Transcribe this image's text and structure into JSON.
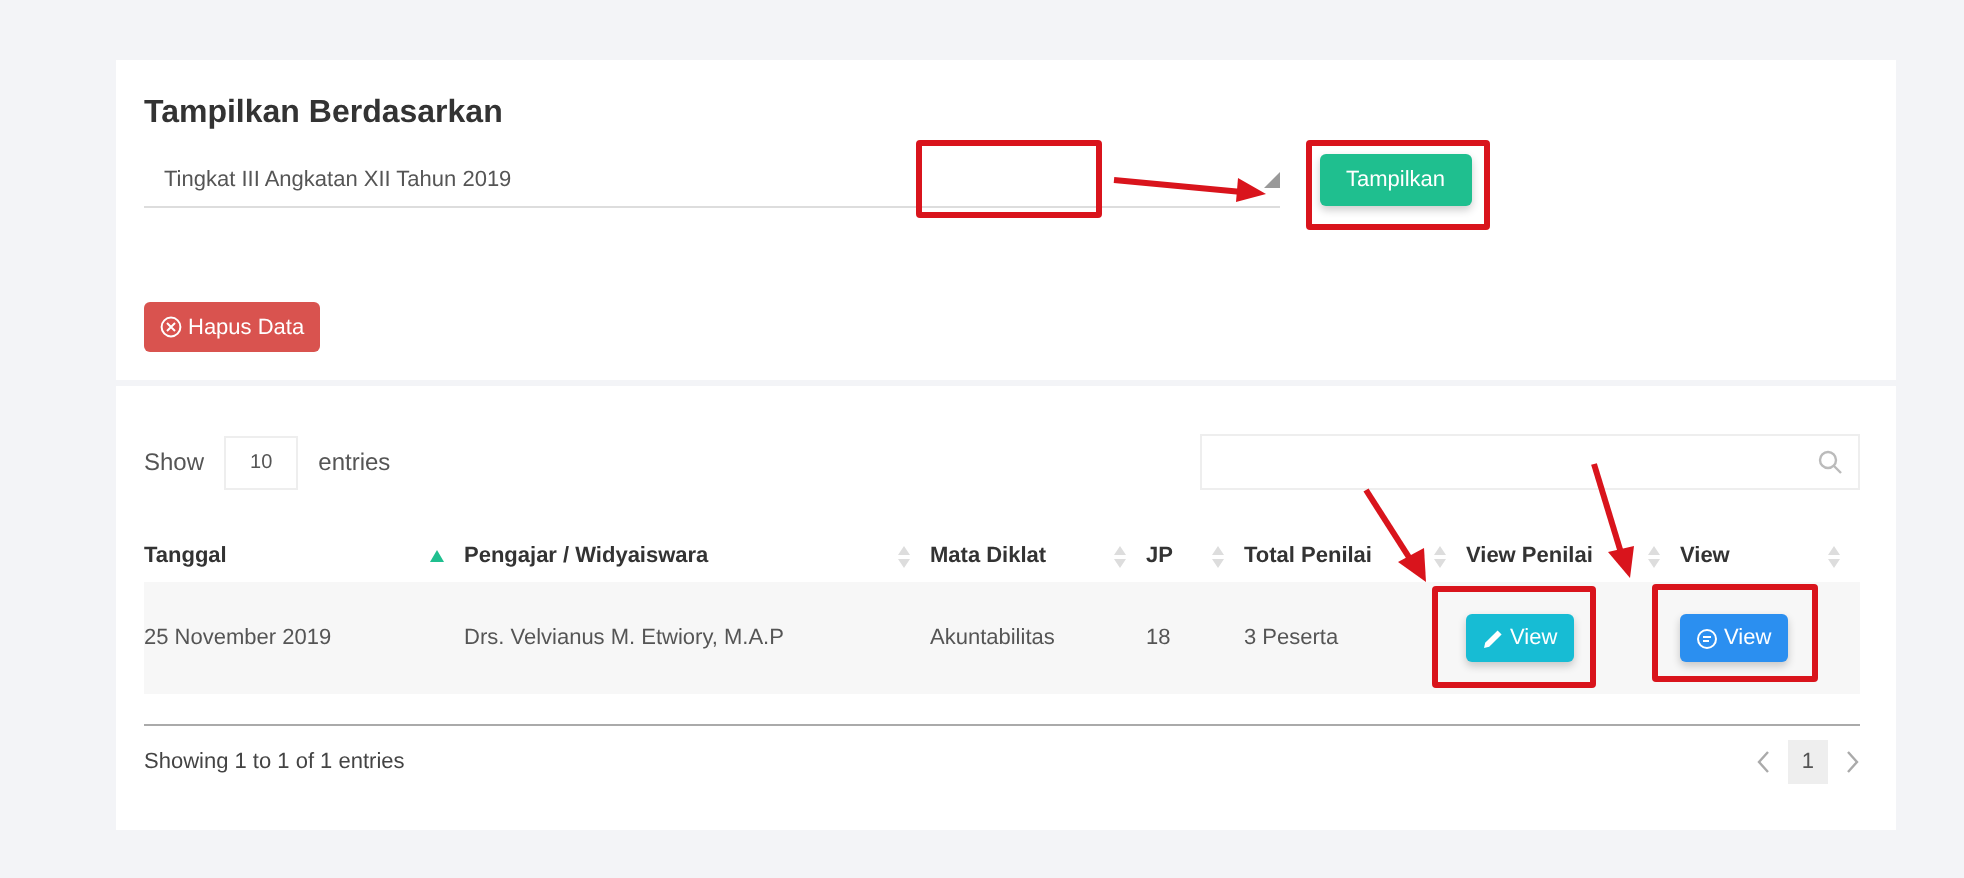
{
  "filter": {
    "title": "Tampilkan Berdasarkan",
    "select_value": "Tingkat III Angkatan XII Tahun 2019",
    "submit_button": "Tampilkan",
    "delete_button": "Hapus Data"
  },
  "table": {
    "length": {
      "prefix": "Show",
      "value": "10",
      "suffix": "entries"
    },
    "columns": [
      {
        "label": "Tanggal",
        "sorted": true
      },
      {
        "label": "Pengajar / Widyaiswara",
        "sorted": false
      },
      {
        "label": "Mata Diklat",
        "sorted": false
      },
      {
        "label": "JP",
        "sorted": false
      },
      {
        "label": "Total Penilai",
        "sorted": false
      },
      {
        "label": "View Penilai",
        "sorted": false
      },
      {
        "label": "View",
        "sorted": false
      }
    ],
    "rows": [
      {
        "cells": [
          {
            "kind": "text",
            "text": "25 November 2019"
          },
          {
            "kind": "text",
            "text": "Drs. Velvianus M. Etwiory, M.A.P"
          },
          {
            "kind": "text",
            "text": "Akuntabilitas"
          },
          {
            "kind": "text",
            "text": "18"
          },
          {
            "kind": "text",
            "text": "3 Peserta"
          },
          {
            "kind": "edit",
            "text": "View"
          },
          {
            "kind": "view",
            "text": "View"
          }
        ]
      }
    ],
    "info": "Showing 1 to 1 of 1 entries",
    "pagination": {
      "pages": [
        {
          "label": "1",
          "selected": true
        }
      ]
    }
  }
}
